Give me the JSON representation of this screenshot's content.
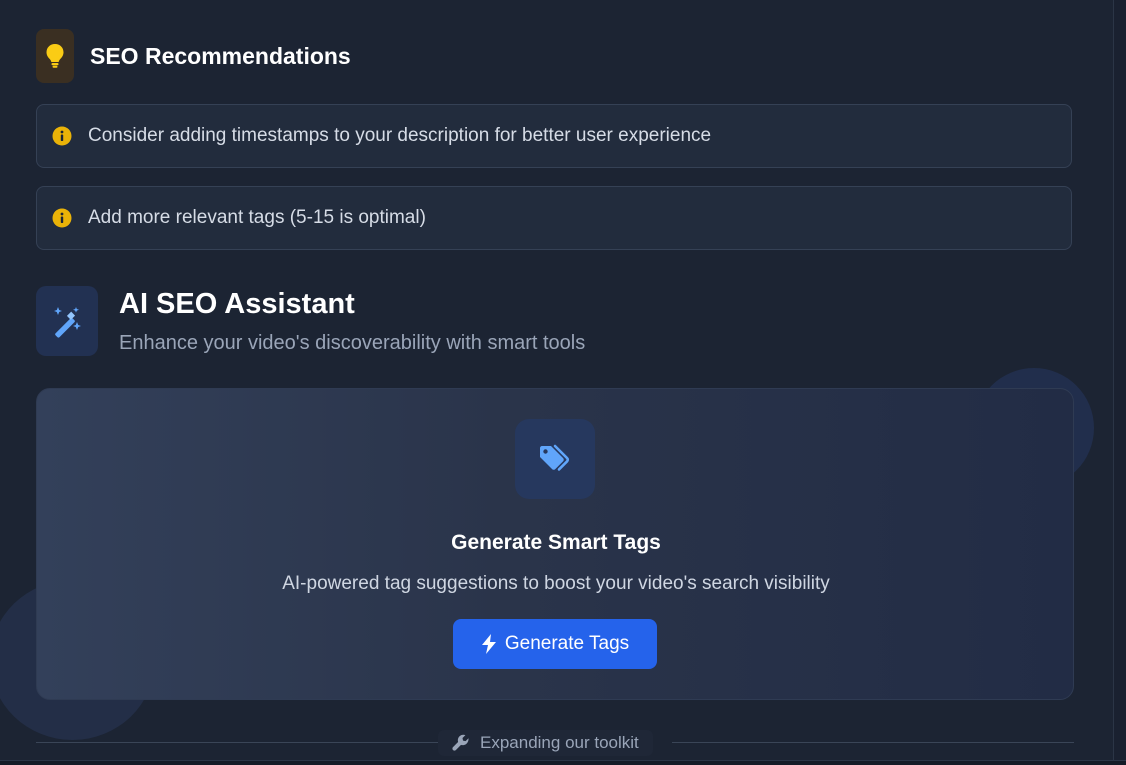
{
  "recommendations": {
    "title": "SEO Recommendations",
    "icon": "lightbulb-icon",
    "items": [
      {
        "text": "Consider adding timestamps to your description for better user experience",
        "icon": "info-icon"
      },
      {
        "text": "Add more relevant tags (5-15 is optimal)",
        "icon": "info-icon"
      }
    ]
  },
  "assistant": {
    "title": "AI SEO Assistant",
    "subtitle": "Enhance your video's discoverability with smart tools",
    "icon": "magic-wand-icon"
  },
  "smart_tags": {
    "icon": "tags-icon",
    "title": "Generate Smart Tags",
    "description": "AI-powered tag suggestions to boost your video's search visibility",
    "button_label": "Generate Tags",
    "button_icon": "bolt-icon"
  },
  "footer": {
    "divider_label": "Expanding our toolkit",
    "divider_icon": "wrench-icon"
  },
  "colors": {
    "background": "#1c2433",
    "accent_blue": "#2563eb",
    "info_yellow": "#eab308",
    "icon_blue": "#60a5fa"
  }
}
